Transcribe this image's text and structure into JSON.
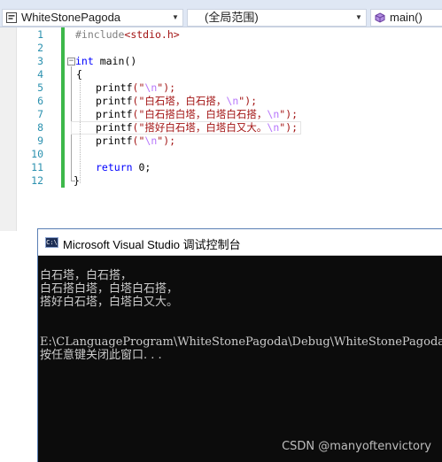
{
  "navbar": {
    "project": "WhiteStonePagoda",
    "scope": "(全局范围)",
    "member": "main()",
    "project_icon": "project-icon",
    "member_icon": "method-cube-icon"
  },
  "editor": {
    "line_numbers": [
      "1",
      "2",
      "3",
      "4",
      "5",
      "6",
      "7",
      "8",
      "9",
      "10",
      "11",
      "12"
    ],
    "line1": {
      "directive": "#include",
      "header": "<stdio.h>"
    },
    "line3": {
      "type": "int",
      "rest": " main()"
    },
    "line4": {
      "brace": "{"
    },
    "line5": {
      "fn": "printf",
      "open": "(\"",
      "esc": "\\n",
      "close": "\");"
    },
    "line6": {
      "fn": "printf",
      "open": "(\"",
      "text": "白石塔，白石搭，",
      "esc": "\\n",
      "close": "\");"
    },
    "line7": {
      "fn": "printf",
      "open": "(\"",
      "text": "白石搭白塔，白塔白石搭，",
      "esc": "\\n",
      "close": "\");"
    },
    "line8": {
      "fn": "printf",
      "open": "(\"",
      "text": "搭好白石塔，白塔白又大。",
      "esc": "\\n",
      "close": "\");"
    },
    "line9": {
      "fn": "printf",
      "open": "(\"",
      "esc": "\\n",
      "close": "\");"
    },
    "line11": {
      "kw": "return",
      "rest": " 0;"
    },
    "line12": {
      "brace": "}"
    }
  },
  "console": {
    "title": "Microsoft Visual Studio 调试控制台",
    "icon": "console-app-icon",
    "output": [
      "白石塔，白石搭，",
      "白石搭白塔，白塔白石搭，",
      "搭好白石塔，白塔白又大。",
      "",
      "",
      "E:\\CLanguageProgram\\WhiteStonePagoda\\Debug\\WhiteStonePagoda.e",
      "按任意键关闭此窗口. . ."
    ]
  },
  "watermark": "CSDN @manyoftenvictory",
  "colors": {
    "keyword": "#0000ff",
    "string": "#a31515",
    "escape": "#b776fb",
    "preprocessor": "#808080",
    "line_number": "#2b91af",
    "change_bar": "#3db84a",
    "console_bg": "#0c0c0c",
    "console_text": "#cccccc"
  }
}
